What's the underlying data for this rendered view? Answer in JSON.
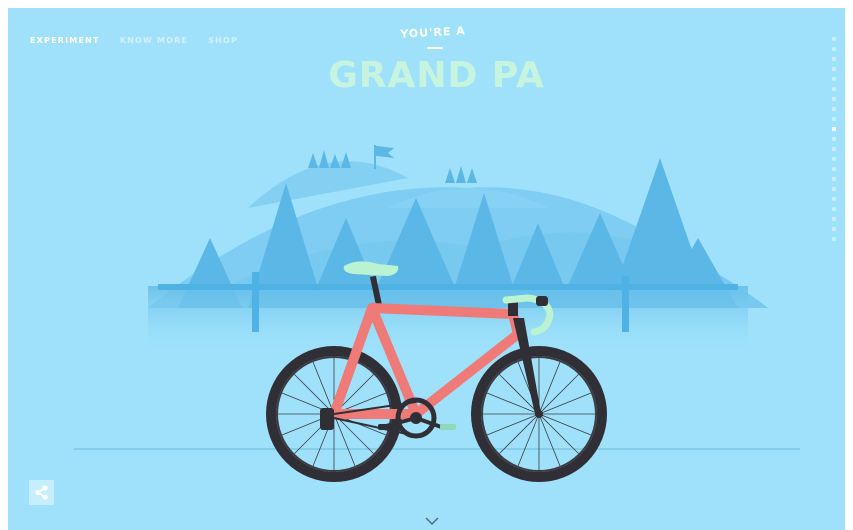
{
  "nav": {
    "items": [
      {
        "label": "EXPERIMENT",
        "active": true
      },
      {
        "label": "KNOW MORE",
        "active": false
      },
      {
        "label": "SHOP",
        "active": false
      }
    ]
  },
  "hero": {
    "kicker": "YOU'RE A",
    "title": "GRAND PA"
  },
  "page_dots": {
    "count": 21,
    "active_index": 9
  },
  "icons": {
    "share": "share-icon",
    "scroll_down": "chevron-down-icon",
    "flag": "flag-icon"
  },
  "colors": {
    "background": "#9fe1fb",
    "title": "#c6f4de",
    "frame": "#ef7b79",
    "saddle_tape": "#b9f3d1",
    "tires": "#2f2f35",
    "trees": "#5bb7e6"
  }
}
